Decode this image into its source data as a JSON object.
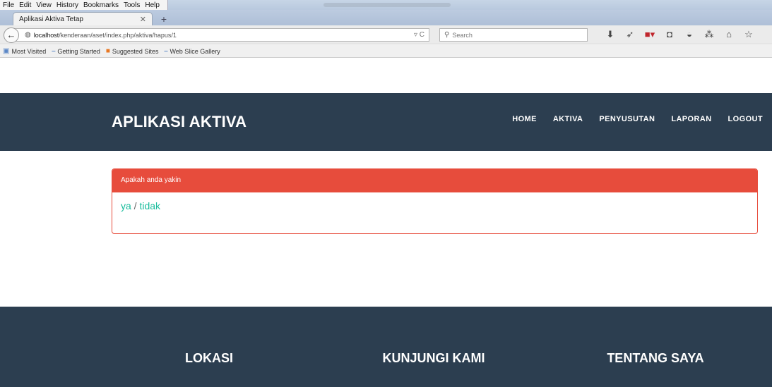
{
  "browser": {
    "menu": [
      "File",
      "Edit",
      "View",
      "History",
      "Bookmarks",
      "Tools",
      "Help"
    ],
    "tab_title": "Aplikasi Aktiva Tetap",
    "url_host": "localhost",
    "url_path": "/kenderaan/aset/index.php/aktiva/hapus/1",
    "search_placeholder": "Search",
    "bookmarks": [
      "Most Visited",
      "Getting Started",
      "Suggested Sites",
      "Web Slice Gallery"
    ]
  },
  "header": {
    "brand": "APLIKASI AKTIVA",
    "nav": [
      "HOME",
      "AKTIVA",
      "PENYUSUTAN",
      "LAPORAN",
      "LOGOUT"
    ]
  },
  "panel": {
    "heading": "Apakah anda yakin",
    "yes": "ya",
    "separator": " / ",
    "no": "tidak"
  },
  "footer": {
    "col1": "LOKASI",
    "col2": "KUNJUNGI KAMI",
    "col3": "TENTANG SAYA"
  },
  "colors": {
    "header_bg": "#2c3e50",
    "danger": "#e74c3c",
    "link": "#18bc9c"
  }
}
